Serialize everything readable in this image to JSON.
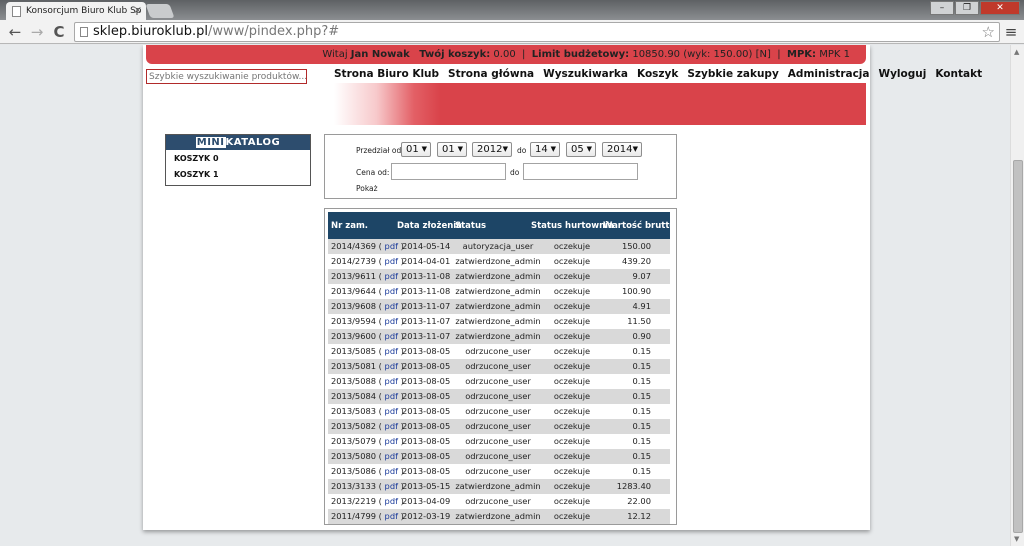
{
  "browser": {
    "tab_title": "Konsorcjum Biuro Klub Sp",
    "tab_close": "×",
    "url_host": "sklep.biuroklub.pl",
    "url_path": "/www/pindex.php?#",
    "back": "←",
    "forward": "→",
    "reload": "C",
    "star": "☆",
    "menu": "≡",
    "win_min": "–",
    "win_max": "❐",
    "win_close": "✕"
  },
  "userbar": {
    "greeting": "Witaj",
    "user_name": "Jan Nowak",
    "cart_label": "Twój koszyk:",
    "cart_value": "0.00",
    "budget_label": "Limit budżetowy:",
    "budget_value": "10850.90 (wyk: 150.00) [N]",
    "sep": "|",
    "mpk_label": "MPK:",
    "mpk_value": "MPK 1"
  },
  "search": {
    "placeholder": "Szybkie wyszukiwanie produktów..."
  },
  "nav": {
    "items": [
      "Strona Biuro Klub",
      "Strona główna",
      "Wyszukiwarka",
      "Koszyk",
      "Szybkie zakupy",
      "Administracja",
      "Wyloguj",
      "Kontakt"
    ]
  },
  "minikatalog": {
    "title_mini": "MINI",
    "title_rest": "KATALOG",
    "items": [
      "KOSZYK 0",
      "KOSZYK 1"
    ]
  },
  "filter": {
    "range_label": "Przedział od",
    "from_day": "01",
    "from_month": "01",
    "from_year": "2012",
    "to_label": "do",
    "to_day": "14",
    "to_month": "05",
    "to_year": "2014",
    "price_label": "Cena od:",
    "price_to_label": "do",
    "show_label": "Pokaż",
    "caret": "▼"
  },
  "orders": {
    "headers": [
      "Nr zam.",
      "Data złożenia",
      "Status",
      "Status hurtownia",
      "Wartość brutto"
    ],
    "pdf_label": "pdf",
    "rows": [
      {
        "nr": "2014/4369",
        "date": "2014-05-14",
        "status": "autoryzacja_user",
        "hurt": "oczekuje",
        "value": "150.00"
      },
      {
        "nr": "2014/2739",
        "date": "2014-04-01",
        "status": "zatwierdzone_admin",
        "hurt": "oczekuje",
        "value": "439.20"
      },
      {
        "nr": "2013/9611",
        "date": "2013-11-08",
        "status": "zatwierdzone_admin",
        "hurt": "oczekuje",
        "value": "9.07"
      },
      {
        "nr": "2013/9644",
        "date": "2013-11-08",
        "status": "zatwierdzone_admin",
        "hurt": "oczekuje",
        "value": "100.90"
      },
      {
        "nr": "2013/9608",
        "date": "2013-11-07",
        "status": "zatwierdzone_admin",
        "hurt": "oczekuje",
        "value": "4.91"
      },
      {
        "nr": "2013/9594",
        "date": "2013-11-07",
        "status": "zatwierdzone_admin",
        "hurt": "oczekuje",
        "value": "11.50"
      },
      {
        "nr": "2013/9600",
        "date": "2013-11-07",
        "status": "zatwierdzone_admin",
        "hurt": "oczekuje",
        "value": "0.90"
      },
      {
        "nr": "2013/5085",
        "date": "2013-08-05",
        "status": "odrzucone_user",
        "hurt": "oczekuje",
        "value": "0.15"
      },
      {
        "nr": "2013/5081",
        "date": "2013-08-05",
        "status": "odrzucone_user",
        "hurt": "oczekuje",
        "value": "0.15"
      },
      {
        "nr": "2013/5088",
        "date": "2013-08-05",
        "status": "odrzucone_user",
        "hurt": "oczekuje",
        "value": "0.15"
      },
      {
        "nr": "2013/5084",
        "date": "2013-08-05",
        "status": "odrzucone_user",
        "hurt": "oczekuje",
        "value": "0.15"
      },
      {
        "nr": "2013/5083",
        "date": "2013-08-05",
        "status": "odrzucone_user",
        "hurt": "oczekuje",
        "value": "0.15"
      },
      {
        "nr": "2013/5082",
        "date": "2013-08-05",
        "status": "odrzucone_user",
        "hurt": "oczekuje",
        "value": "0.15"
      },
      {
        "nr": "2013/5079",
        "date": "2013-08-05",
        "status": "odrzucone_user",
        "hurt": "oczekuje",
        "value": "0.15"
      },
      {
        "nr": "2013/5080",
        "date": "2013-08-05",
        "status": "odrzucone_user",
        "hurt": "oczekuje",
        "value": "0.15"
      },
      {
        "nr": "2013/5086",
        "date": "2013-08-05",
        "status": "odrzucone_user",
        "hurt": "oczekuje",
        "value": "0.15"
      },
      {
        "nr": "2013/3133",
        "date": "2013-05-15",
        "status": "zatwierdzone_admin",
        "hurt": "oczekuje",
        "value": "1283.40"
      },
      {
        "nr": "2013/2219",
        "date": "2013-04-09",
        "status": "odrzucone_user",
        "hurt": "oczekuje",
        "value": "22.00"
      },
      {
        "nr": "2011/4799",
        "date": "2012-03-19",
        "status": "zatwierdzone_admin",
        "hurt": "oczekuje",
        "value": "12.12"
      }
    ]
  }
}
